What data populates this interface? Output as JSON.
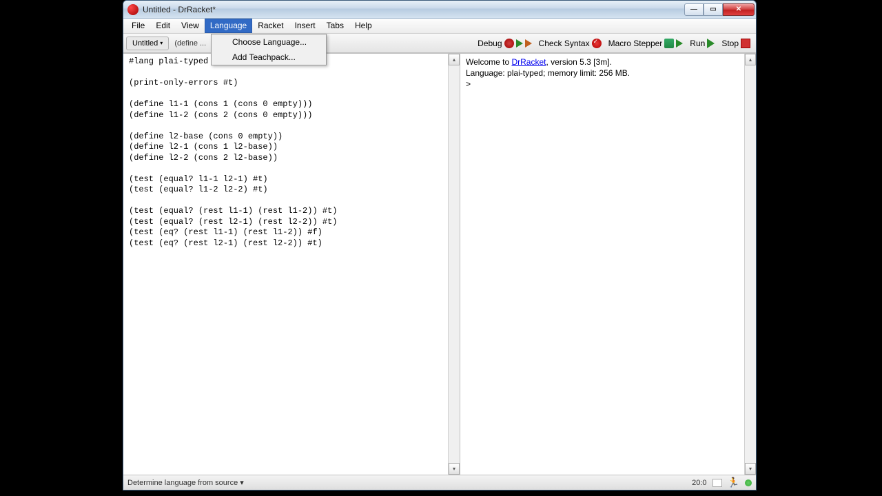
{
  "window": {
    "title": "Untitled - DrRacket*"
  },
  "menus": {
    "file": "File",
    "edit": "Edit",
    "view": "View",
    "language": "Language",
    "racket": "Racket",
    "insert": "Insert",
    "tabs": "Tabs",
    "help": "Help"
  },
  "language_menu": {
    "choose": "Choose Language...",
    "add_teachpack": "Add Teachpack..."
  },
  "tabs": {
    "current": "Untitled",
    "path": "(define ..."
  },
  "toolbar": {
    "debug": "Debug",
    "check_syntax": "Check Syntax",
    "macro_stepper": "Macro Stepper",
    "run": "Run",
    "stop": "Stop"
  },
  "editor": {
    "code": "#lang plai-typed\n\n(print-only-errors #t)\n\n(define l1-1 (cons 1 (cons 0 empty)))\n(define l1-2 (cons 2 (cons 0 empty)))\n\n(define l2-base (cons 0 empty))\n(define l2-1 (cons 1 l2-base))\n(define l2-2 (cons 2 l2-base))\n\n(test (equal? l1-1 l2-1) #t)\n(test (equal? l1-2 l2-2) #t)\n\n(test (equal? (rest l1-1) (rest l1-2)) #t)\n(test (equal? (rest l2-1) (rest l2-2)) #t)\n(test (eq? (rest l1-1) (rest l1-2)) #f)\n(test (eq? (rest l2-1) (rest l2-2)) #t)"
  },
  "repl": {
    "welcome_prefix": "Welcome to ",
    "link": "DrRacket",
    "welcome_suffix": ", version 5.3 [3m].",
    "lang_line": "Language: plai-typed; memory limit: 256 MB.",
    "prompt": "> "
  },
  "status": {
    "language": "Determine language from source",
    "position": "20:0"
  },
  "glyphs": {
    "min": "—",
    "max": "▭",
    "close": "✕",
    "caret_down": "▾",
    "arrow_up": "▴",
    "arrow_down": "▾"
  }
}
